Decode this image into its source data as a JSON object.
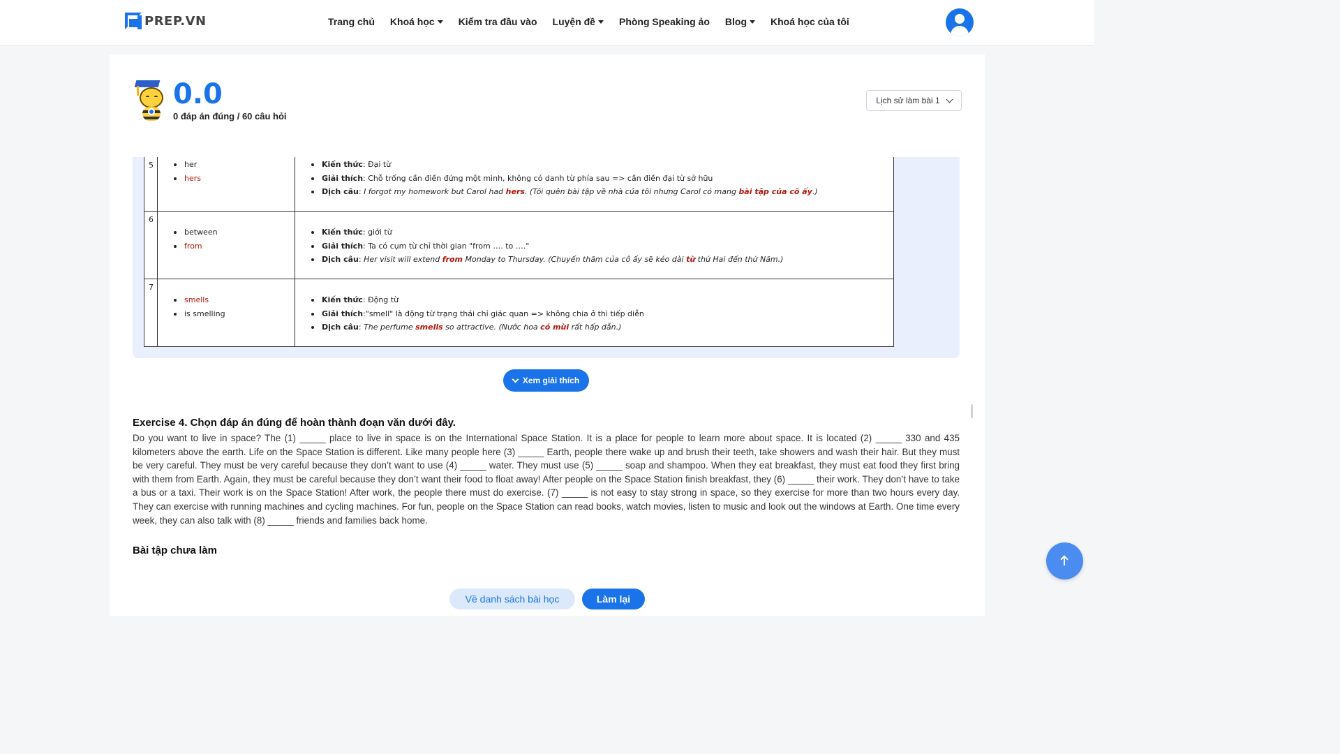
{
  "header": {
    "logo_text": "PREP.VN",
    "nav": [
      {
        "label": "Trang chủ",
        "caret": false
      },
      {
        "label": "Khoá học",
        "caret": true
      },
      {
        "label": "Kiểm tra đầu vào",
        "caret": false
      },
      {
        "label": "Luyện đề",
        "caret": true
      },
      {
        "label": "Phòng Speaking ảo",
        "caret": false
      },
      {
        "label": "Blog",
        "caret": true
      },
      {
        "label": "Khoá học của tôi",
        "caret": false
      }
    ],
    "avatar_icon": "user-avatar-icon"
  },
  "score": {
    "value": "0.0",
    "summary": "0 đáp án đúng / 60 câu hỏi"
  },
  "history_select": {
    "label": "Lịch sử làm bài 1"
  },
  "explanations": [
    {
      "num": "5",
      "options": [
        {
          "text": "her",
          "correct": false
        },
        {
          "text": "hers",
          "correct": true
        }
      ],
      "knowledge_label": "Kiến thức",
      "knowledge": "Đại từ",
      "reason_label": "Giải thích",
      "reason": "Chỗ trống cần điền đứng một mình, không có danh từ phía sau => cần điền đại từ sở hữu",
      "translation_label": "Dịch câu",
      "translation_pre": " I forgot my homework but Carol had ",
      "translation_ans": "hers",
      "translation_mid": ". (Tôi quên bài tập về nhà của tôi nhưng Carol có mang ",
      "translation_ans2": "bài tập của cô ấy",
      "translation_post": ".)"
    },
    {
      "num": "6",
      "options": [
        {
          "text": "between",
          "correct": false
        },
        {
          "text": "from",
          "correct": true
        }
      ],
      "knowledge_label": "Kiến thức",
      "knowledge": "giới từ",
      "reason_label": "Giải thích",
      "reason": "Ta có cụm từ chỉ thời gian \"from …. to ….\"",
      "translation_label": "Dịch câu",
      "translation_pre": "Her visit will extend ",
      "translation_ans": "from",
      "translation_mid": " Monday to Thursday. (Chuyến thăm của cô ấy sẽ kéo dài ",
      "translation_ans2": "từ",
      "translation_post": " thứ Hai đến thứ Năm.)"
    },
    {
      "num": "7",
      "options": [
        {
          "text": "smells",
          "correct": true
        },
        {
          "text": "is smelling",
          "correct": false
        }
      ],
      "knowledge_label": "Kiến thức",
      "knowledge": "Động từ",
      "reason_label": "Giải thích",
      "reason": "\"smell\" là động từ trạng thái chỉ giác quan => không chia ở thì tiếp diễn",
      "translation_label": "Dịch câu",
      "translation_pre": "The perfume ",
      "translation_ans": "smells",
      "translation_mid": " so attractive. (Nước hoa ",
      "translation_ans2": "có mùi",
      "translation_post": " rất hấp dẫn.)"
    }
  ],
  "explain_button": {
    "label": "Xem giải thích"
  },
  "exercise": {
    "title": "Exercise 4. Chọn đáp án đúng để hoàn thành đoạn văn dưới đây.",
    "passage": "Do you want to live in space? The (1) _____ place to live in space is on the International Space Station. It is a place for people to learn more about space. It is located (2) _____ 330 and 435 kilometers above the earth. Life on the Space Station is different. Like many people here (3) _____ Earth, people there wake up and brush their teeth, take showers and wash their hair. But they must be very careful. They must be very careful because they don’t want to use (4) _____ water. They must use (5) _____ soap and shampoo. When they eat breakfast, they must eat food they first bring with them from Earth. Again, they must be careful because they don’t want their food to float away! After people on the Space Station finish breakfast, they (6) _____ their work. They don’t have to take a bus or a taxi. Their work is on the Space Station! After work, the people there must do exercise. (7) _____ is not easy to stay strong in space, so they exercise for more than two hours every day. They can exercise with running machines and cycling machines. For fun, people on the Space Station can read books, watch movies, listen to music and look out the windows at Earth. One time every week, they can also talk with (8) _____ friends and families back home."
  },
  "unfinished_label": "Bài tập chưa làm",
  "footer_buttons": {
    "back": "Về danh sách bài học",
    "redo": "Làm lại"
  },
  "colors": {
    "primary": "#1a73e8",
    "correct_answer": "#b1150b",
    "panel_bg": "#eaeffd"
  }
}
